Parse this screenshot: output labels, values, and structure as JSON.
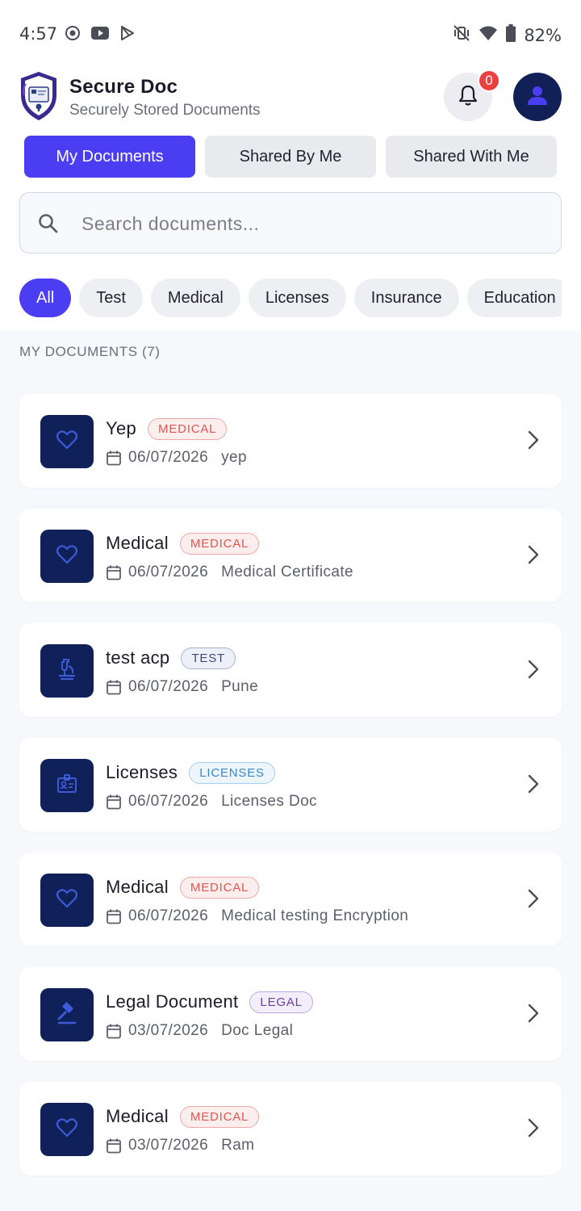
{
  "status_bar": {
    "time": "4:57",
    "battery": "82%"
  },
  "header": {
    "title": "Secure Doc",
    "subtitle": "Securely Stored Documents",
    "notification_count": "0"
  },
  "tabs": [
    {
      "label": "My Documents",
      "active": true
    },
    {
      "label": "Shared By Me",
      "active": false
    },
    {
      "label": "Shared With Me",
      "active": false
    }
  ],
  "search": {
    "placeholder": "Search documents..."
  },
  "filters": [
    {
      "label": "All",
      "active": true
    },
    {
      "label": "Test"
    },
    {
      "label": "Medical"
    },
    {
      "label": "Licenses"
    },
    {
      "label": "Insurance"
    },
    {
      "label": "Education"
    }
  ],
  "section": {
    "title": "MY DOCUMENTS (7)"
  },
  "documents": [
    {
      "title": "Yep",
      "tag": "MEDICAL",
      "date": "06/07/2026",
      "description": "yep",
      "icon": "heart-icon"
    },
    {
      "title": "Medical",
      "tag": "MEDICAL",
      "date": "06/07/2026",
      "description": "Medical Certificate",
      "icon": "heart-icon"
    },
    {
      "title": "test acp",
      "tag": "TEST",
      "date": "06/07/2026",
      "description": "Pune",
      "icon": "microscope-icon"
    },
    {
      "title": "Licenses",
      "tag": "LICENSES",
      "date": "06/07/2026",
      "description": "Licenses Doc",
      "icon": "id-card-icon"
    },
    {
      "title": "Medical",
      "tag": "MEDICAL",
      "date": "06/07/2026",
      "description": "Medical testing Encryption",
      "icon": "heart-icon"
    },
    {
      "title": "Legal Document",
      "tag": "LEGAL",
      "date": "03/07/2026",
      "description": "Doc Legal",
      "icon": "gavel-icon"
    },
    {
      "title": "Medical",
      "tag": "MEDICAL",
      "date": "03/07/2026",
      "description": "Ram",
      "icon": "heart-icon"
    }
  ],
  "colors": {
    "accent": "#4b3df2",
    "navy": "#102058",
    "badge_red": "#e8413f"
  }
}
